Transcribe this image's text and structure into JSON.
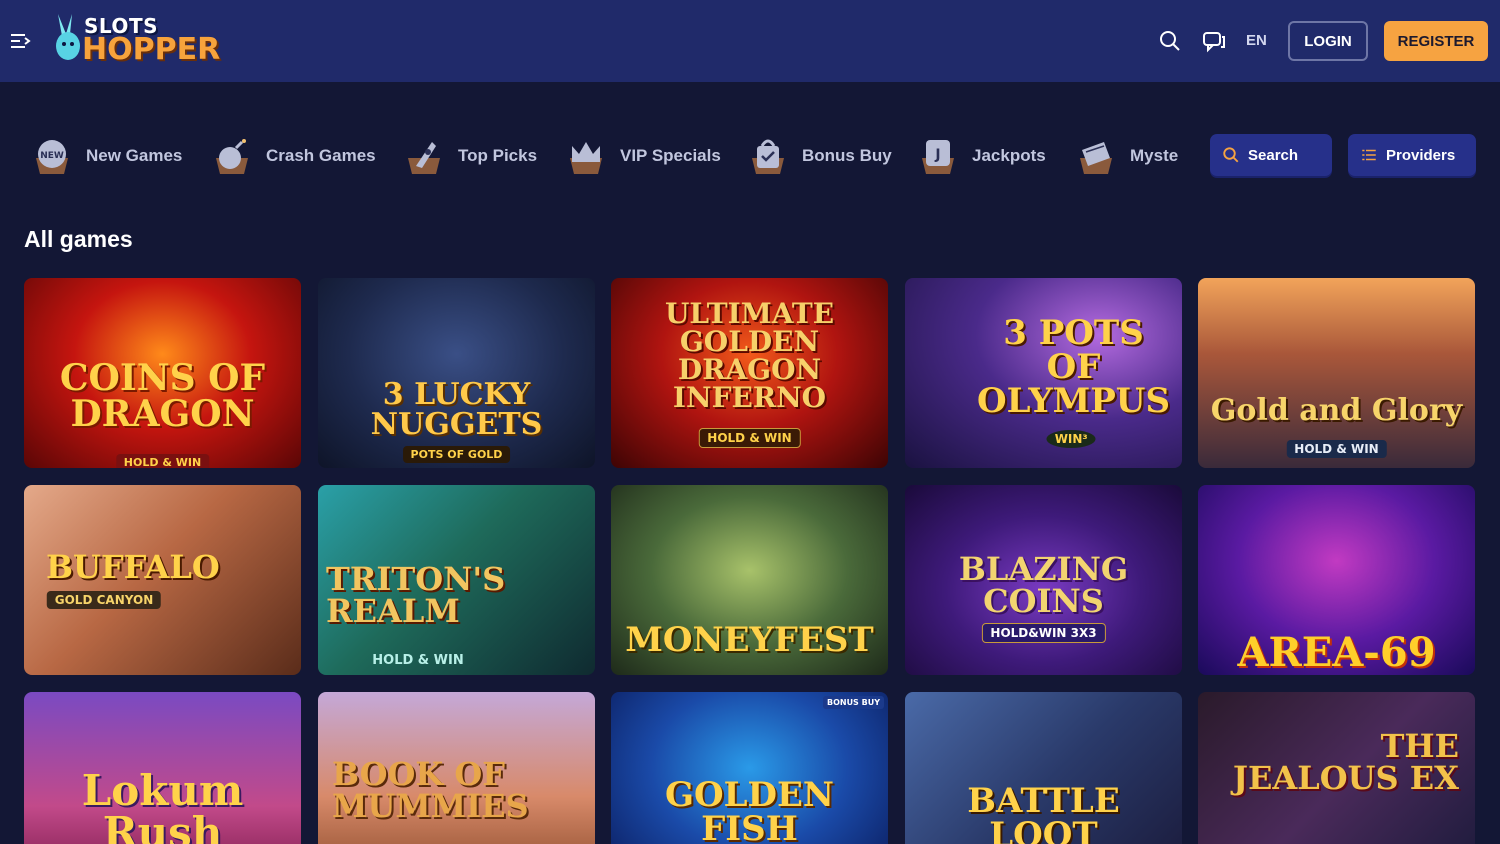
{
  "header": {
    "logo_top": "SLOTS",
    "logo_bottom": "HOPPER",
    "language": "EN",
    "login_label": "LOGIN",
    "register_label": "REGISTER",
    "icons": [
      "menu-icon",
      "search-icon",
      "chat-icon"
    ]
  },
  "categories": [
    {
      "label": "New Games",
      "icon": "new-badge-icon"
    },
    {
      "label": "Crash Games",
      "icon": "bomb-icon"
    },
    {
      "label": "Top Picks",
      "icon": "rocket-icon"
    },
    {
      "label": "VIP Specials",
      "icon": "crown-icon"
    },
    {
      "label": "Bonus Buy",
      "icon": "shopping-bag-icon"
    },
    {
      "label": "Jackpots",
      "icon": "jackpot-icon"
    },
    {
      "label": "Myste",
      "icon": "mystery-book-icon"
    }
  ],
  "nav_buttons": {
    "search_label": "Search",
    "providers_label": "Providers"
  },
  "section": {
    "title": "All games"
  },
  "games": [
    {
      "name": "COINS OF DRAGON",
      "sub": "HOLD & WIN"
    },
    {
      "name": "3 LUCKY NUGGETS",
      "sub": "POTS OF GOLD"
    },
    {
      "name": "ULTIMATE GOLDEN DRAGON INFERNO",
      "sub": "HOLD & WIN"
    },
    {
      "name": "3 POTS OF OLYMPUS",
      "sub": "WIN³"
    },
    {
      "name": "Gold and Glory",
      "sub": "HOLD & WIN"
    },
    {
      "name": "BUFFALO",
      "sub": "GOLD CANYON"
    },
    {
      "name": "TRITON'S REALM",
      "sub": "HOLD & WIN"
    },
    {
      "name": "MONEYFEST",
      "sub": ""
    },
    {
      "name": "BLAZING COINS",
      "sub": "HOLD&WIN 3X3"
    },
    {
      "name": "AREA-69",
      "sub": ""
    },
    {
      "name": "Lokum Rush",
      "sub": ""
    },
    {
      "name": "BOOK OF MUMMIES",
      "sub": ""
    },
    {
      "name": "GOLDEN FISH",
      "sub": "",
      "badge": "BONUS BUY"
    },
    {
      "name": "BATTLE LOOT",
      "sub": ""
    },
    {
      "name": "THE JEALOUS EX",
      "sub": ""
    }
  ]
}
